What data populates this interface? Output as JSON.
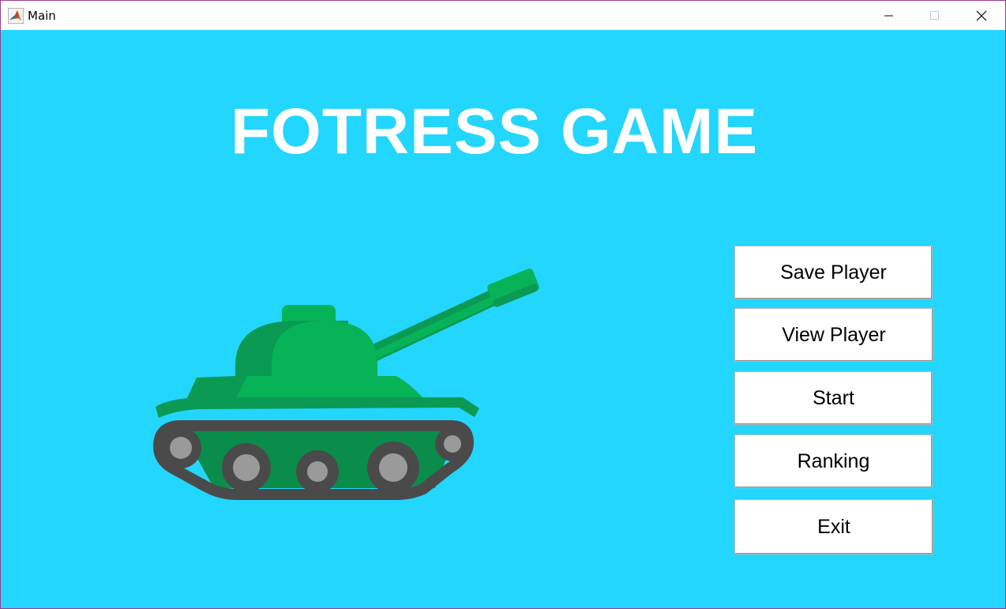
{
  "window": {
    "title": "Main",
    "controls": {
      "minimize_icon": "minimize-icon",
      "maximize_icon": "maximize-icon",
      "close_icon": "close-icon"
    }
  },
  "app_icon": "matlab-icon",
  "game": {
    "title": "FOTRESS GAME",
    "illustration": "tank-icon"
  },
  "menu": {
    "save_player": "Save Player",
    "view_player": "View Player",
    "start": "Start",
    "ranking": "Ranking",
    "exit": "Exit"
  },
  "colors": {
    "background": "#22d6fe",
    "title_text": "#ffffff",
    "tank_light": "#06b357",
    "tank_dark": "#0a9a53",
    "tread": "#4a4a4a",
    "wheel": "#999999"
  }
}
